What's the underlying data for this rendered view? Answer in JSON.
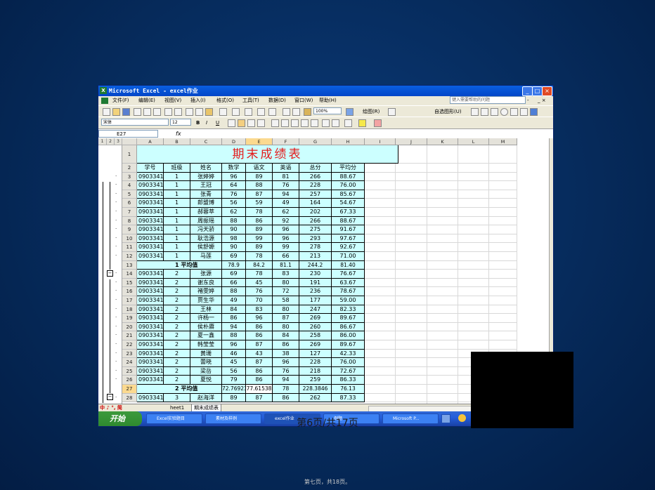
{
  "window": {
    "title": "Microsoft Excel - excel作业",
    "controls": [
      "_",
      "□",
      "×"
    ]
  },
  "menu": {
    "items": [
      "文件(F)",
      "编辑(E)",
      "视图(V)",
      "插入(I)",
      "格式(O)",
      "工具(T)",
      "数据(D)",
      "窗口(W)",
      "帮助(H)"
    ],
    "help_placeholder": "键入需要帮助的问题",
    "right_controls": [
      "-",
      "_ ×"
    ]
  },
  "toolbar": {
    "zoom": "100%",
    "draw_label": "绘图(R)",
    "autoshape_label": "自选图形(U)",
    "font_name": "宋体",
    "font_size": "12",
    "bold": "B",
    "italic": "I",
    "underline": "U"
  },
  "formula_bar": {
    "name_box": "E27",
    "fx": "fx",
    "content": ""
  },
  "sheet": {
    "outline_levels": [
      "1",
      "2",
      "3"
    ],
    "columns": [
      "A",
      "B",
      "C",
      "D",
      "E",
      "F",
      "G",
      "H",
      "I",
      "J",
      "K",
      "L",
      "M"
    ],
    "selected_column": "E",
    "title": "期末成绩表",
    "headers": [
      "学号",
      "班级",
      "姓名",
      "数学",
      "语文",
      "英语",
      "总分",
      "平均分"
    ],
    "rows": [
      {
        "r": "3",
        "cells": [
          "090334101",
          "1",
          "张婷婷",
          "96",
          "89",
          "81",
          "266",
          "88.67"
        ]
      },
      {
        "r": "4",
        "cells": [
          "090334102",
          "1",
          "王冠",
          "64",
          "88",
          "76",
          "228",
          "76.00"
        ]
      },
      {
        "r": "5",
        "cells": [
          "090334103",
          "1",
          "张青",
          "76",
          "87",
          "94",
          "257",
          "85.67"
        ]
      },
      {
        "r": "6",
        "cells": [
          "090334104",
          "1",
          "郎盟博",
          "56",
          "59",
          "49",
          "164",
          "54.67"
        ]
      },
      {
        "r": "7",
        "cells": [
          "090334105",
          "1",
          "郝蓉萃",
          "62",
          "78",
          "62",
          "202",
          "67.33"
        ]
      },
      {
        "r": "8",
        "cells": [
          "090334106",
          "1",
          "周振瑶",
          "88",
          "86",
          "92",
          "266",
          "88.67"
        ]
      },
      {
        "r": "9",
        "cells": [
          "090334107",
          "1",
          "冯天骄",
          "90",
          "89",
          "96",
          "275",
          "91.67"
        ]
      },
      {
        "r": "10",
        "cells": [
          "090334108",
          "1",
          "耿浩源",
          "98",
          "99",
          "96",
          "293",
          "97.67"
        ]
      },
      {
        "r": "11",
        "cells": [
          "090334109",
          "1",
          "侯舒嫄",
          "90",
          "89",
          "99",
          "278",
          "92.67"
        ]
      },
      {
        "r": "12",
        "cells": [
          "090334110",
          "1",
          "马莲",
          "69",
          "78",
          "66",
          "213",
          "71.00"
        ]
      },
      {
        "r": "13",
        "avg": true,
        "cells": [
          "",
          "1 平均值",
          "",
          "78.9",
          "84.2",
          "81.1",
          "244.2",
          "81.40"
        ]
      },
      {
        "r": "14",
        "cells": [
          "090334111",
          "2",
          "张源",
          "69",
          "78",
          "83",
          "230",
          "76.67"
        ]
      },
      {
        "r": "15",
        "cells": [
          "090334112",
          "2",
          "谢东良",
          "66",
          "45",
          "80",
          "191",
          "63.67"
        ]
      },
      {
        "r": "16",
        "cells": [
          "090334113",
          "2",
          "褚雯婷",
          "88",
          "76",
          "72",
          "236",
          "78.67"
        ]
      },
      {
        "r": "17",
        "cells": [
          "090334114",
          "2",
          "贾生华",
          "49",
          "70",
          "58",
          "177",
          "59.00"
        ]
      },
      {
        "r": "18",
        "cells": [
          "090334115",
          "2",
          "王林",
          "84",
          "83",
          "80",
          "247",
          "82.33"
        ]
      },
      {
        "r": "19",
        "cells": [
          "090334116",
          "2",
          "许杨一",
          "86",
          "96",
          "87",
          "269",
          "89.67"
        ]
      },
      {
        "r": "20",
        "cells": [
          "090334117",
          "2",
          "侯朴赓",
          "94",
          "86",
          "80",
          "260",
          "86.67"
        ]
      },
      {
        "r": "21",
        "cells": [
          "090334118",
          "2",
          "夏一鑫",
          "88",
          "86",
          "84",
          "258",
          "86.00"
        ]
      },
      {
        "r": "22",
        "cells": [
          "090334119",
          "2",
          "韩莹莹",
          "96",
          "87",
          "86",
          "269",
          "89.67"
        ]
      },
      {
        "r": "23",
        "cells": [
          "090334120",
          "2",
          "黄珊",
          "46",
          "43",
          "38",
          "127",
          "42.33"
        ]
      },
      {
        "r": "24",
        "cells": [
          "090334121",
          "2",
          "蕾晓",
          "45",
          "87",
          "96",
          "228",
          "76.00"
        ]
      },
      {
        "r": "25",
        "cells": [
          "090334122",
          "2",
          "梁岳",
          "56",
          "86",
          "76",
          "218",
          "72.67"
        ]
      },
      {
        "r": "26",
        "cells": [
          "090334123",
          "2",
          "夏悦",
          "79",
          "86",
          "94",
          "259",
          "86.33"
        ]
      },
      {
        "r": "27",
        "avg": true,
        "cells": [
          "",
          "2 平均值",
          "",
          "72.76923",
          "77.61538",
          "78",
          "228.3846",
          "76.13"
        ]
      },
      {
        "r": "28",
        "cells": [
          "090334124",
          "3",
          "赵海洋",
          "89",
          "87",
          "86",
          "262",
          "87.33"
        ]
      }
    ],
    "selected_row": "27",
    "tabs": [
      "heet1",
      "期末成绩表"
    ],
    "ime_label": "中 ♪ °, 简"
  },
  "taskbar": {
    "start_label": "开始",
    "tasks": [
      "Excel实验题目",
      "素材及样例",
      "excel作业",
      "例题",
      "Microsoft P..."
    ]
  },
  "slide": {
    "page_indicator": "第6页/共17页",
    "footer": "第七页，共18页。"
  }
}
